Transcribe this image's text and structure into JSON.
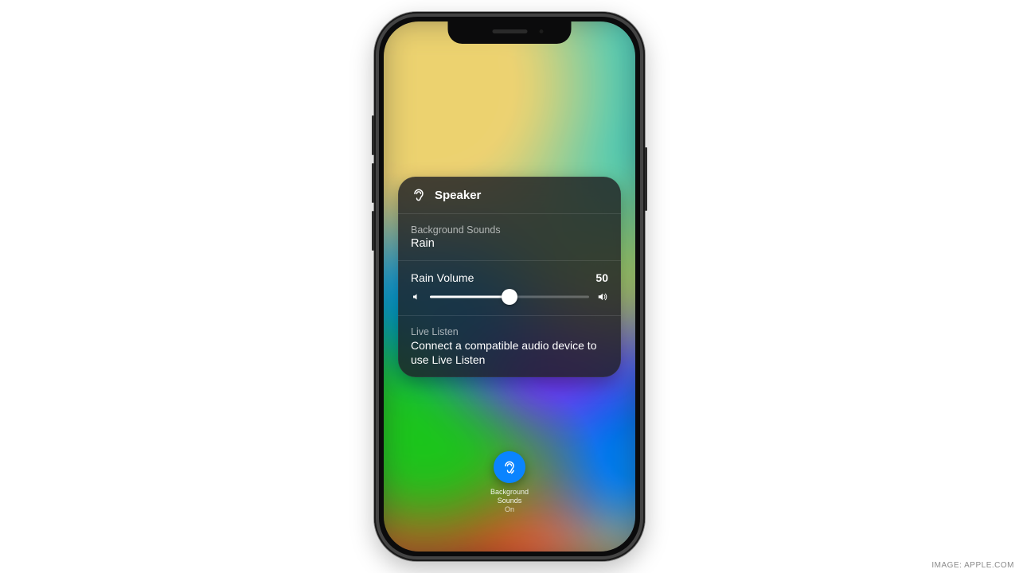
{
  "colors": {
    "accent": "#0a84ff"
  },
  "panel": {
    "header": {
      "icon": "ear-icon",
      "title": "Speaker"
    },
    "background_sounds": {
      "label": "Background Sounds",
      "value": "Rain"
    },
    "volume": {
      "label": "Rain Volume",
      "value": 50,
      "min_icon": "volume-low-icon",
      "max_icon": "volume-high-icon"
    },
    "live_listen": {
      "label": "Live Listen",
      "message": "Connect a compatible audio device to use Live Listen"
    }
  },
  "cc_tile": {
    "icon": "ear-icon",
    "label_line1": "Background",
    "label_line2": "Sounds",
    "status": "On"
  },
  "credit": "IMAGE: APPLE.COM"
}
